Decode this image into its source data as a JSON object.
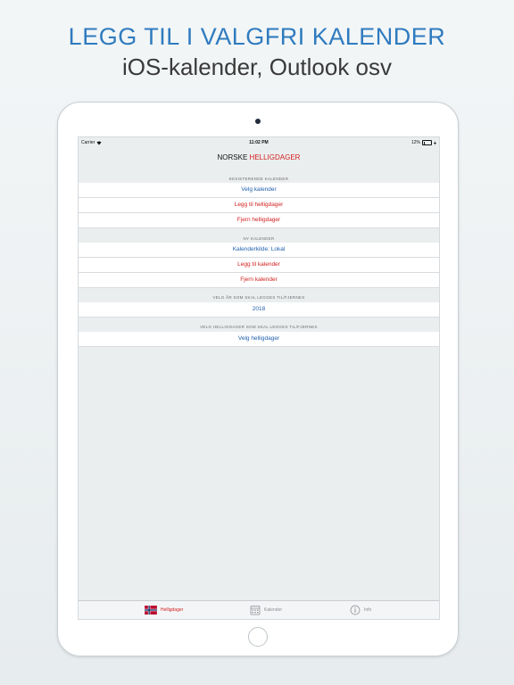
{
  "headline": "LEGG TIL I VALGFRI KALENDER",
  "subline": "iOS-kalender, Outlook osv",
  "status": {
    "carrier": "Carrier",
    "time": "11:02 PM",
    "battery": "12%"
  },
  "navbar": {
    "title_part1": "NORSKE ",
    "title_part2": "HELLIGDAGER"
  },
  "sections": {
    "existing": {
      "header": "EKSISTERENDE KALENDER",
      "select_calendar": "Velg kalender",
      "add_holidays": "Legg til helligdager",
      "remove_holidays": "Fjern helligdager"
    },
    "new": {
      "header": "NY KALENDER",
      "source": "Kalenderkilde: Lokal",
      "add_calendar": "Legg til kalender",
      "remove_calendar": "Fjern kalender"
    },
    "year": {
      "header": "VELG ÅR SOM SKAL LEGGES TIL/FJERNES",
      "value": "2018"
    },
    "holidays": {
      "header": "VELG HELLIGDAGER SOM SKAL LEGGES TIL/FJERNES",
      "select": "Velg helligdager"
    }
  },
  "tabbar": {
    "tabs": [
      {
        "label": "Helligdager",
        "icon": "norway-flag-icon",
        "active": true
      },
      {
        "label": "Kalender",
        "icon": "calendar-icon",
        "active": false
      },
      {
        "label": "Info",
        "icon": "info-icon",
        "active": false
      }
    ]
  },
  "colors": {
    "accent_red": "#d21f1f",
    "link_blue": "#1f5fae",
    "headline_blue": "#2f7bbf"
  }
}
